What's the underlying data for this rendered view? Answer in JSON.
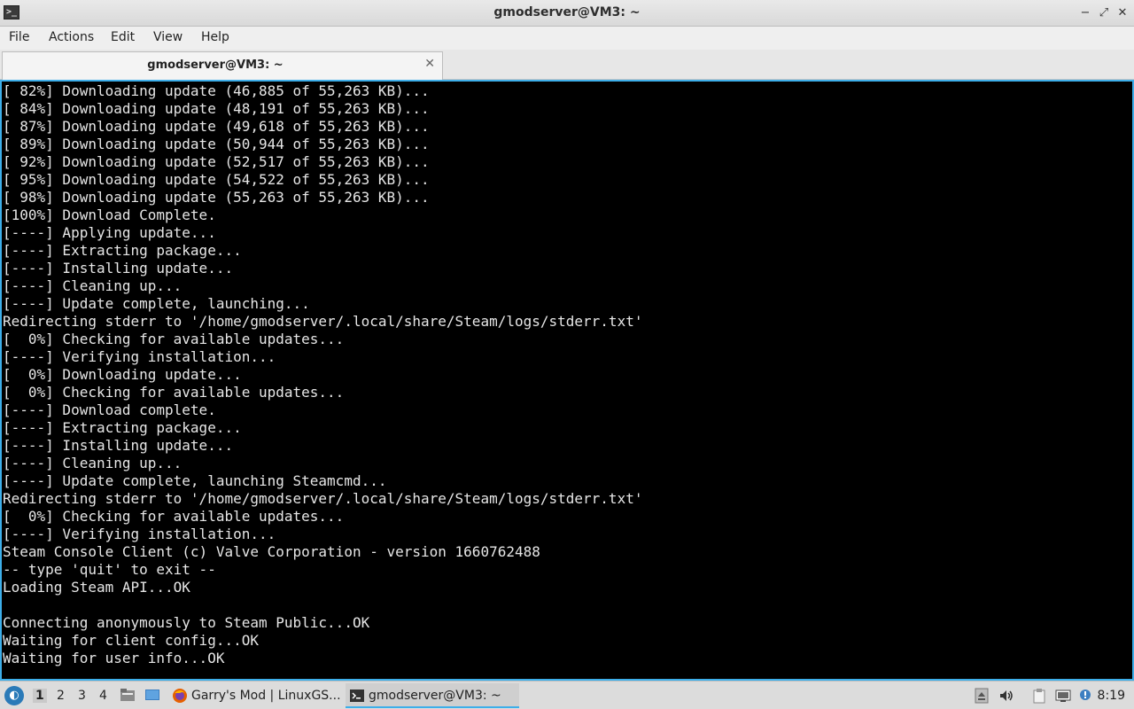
{
  "window": {
    "title": "gmodserver@VM3: ~",
    "minimize_glyph": "−",
    "restore_glyph": "⤢",
    "close_glyph": "✕",
    "app_icon_glyph": ">_"
  },
  "menubar": {
    "items": [
      {
        "label": "File"
      },
      {
        "label": "Actions"
      },
      {
        "label": "Edit"
      },
      {
        "label": "View"
      },
      {
        "label": "Help"
      }
    ]
  },
  "tabs": [
    {
      "label": "gmodserver@VM3: ~",
      "close_glyph": "✕"
    }
  ],
  "terminal": {
    "lines": [
      "[ 82%] Downloading update (46,885 of 55,263 KB)...",
      "[ 84%] Downloading update (48,191 of 55,263 KB)...",
      "[ 87%] Downloading update (49,618 of 55,263 KB)...",
      "[ 89%] Downloading update (50,944 of 55,263 KB)...",
      "[ 92%] Downloading update (52,517 of 55,263 KB)...",
      "[ 95%] Downloading update (54,522 of 55,263 KB)...",
      "[ 98%] Downloading update (55,263 of 55,263 KB)...",
      "[100%] Download Complete.",
      "[----] Applying update...",
      "[----] Extracting package...",
      "[----] Installing update...",
      "[----] Cleaning up...",
      "[----] Update complete, launching...",
      "Redirecting stderr to '/home/gmodserver/.local/share/Steam/logs/stderr.txt'",
      "[  0%] Checking for available updates...",
      "[----] Verifying installation...",
      "[  0%] Downloading update...",
      "[  0%] Checking for available updates...",
      "[----] Download complete.",
      "[----] Extracting package...",
      "[----] Installing update...",
      "[----] Cleaning up...",
      "[----] Update complete, launching Steamcmd...",
      "Redirecting stderr to '/home/gmodserver/.local/share/Steam/logs/stderr.txt'",
      "[  0%] Checking for available updates...",
      "[----] Verifying installation...",
      "Steam Console Client (c) Valve Corporation - version 1660762488",
      "-- type 'quit' to exit --",
      "Loading Steam API...OK",
      "",
      "Connecting anonymously to Steam Public...OK",
      "Waiting for client config...OK",
      "Waiting for user info...OK"
    ]
  },
  "taskbar": {
    "desktops": [
      "1",
      "2",
      "3",
      "4"
    ],
    "active_desktop": "1",
    "tasks": [
      {
        "label": "Garry's Mod | LinuxGS...",
        "icon": "firefox-icon"
      },
      {
        "label": "gmodserver@VM3: ~",
        "icon": "terminal-icon"
      }
    ],
    "clock": "8:19",
    "colors": {
      "accent": "#3daee9",
      "terminal_bg": "#000000",
      "terminal_fg": "#e6e6e6"
    }
  }
}
